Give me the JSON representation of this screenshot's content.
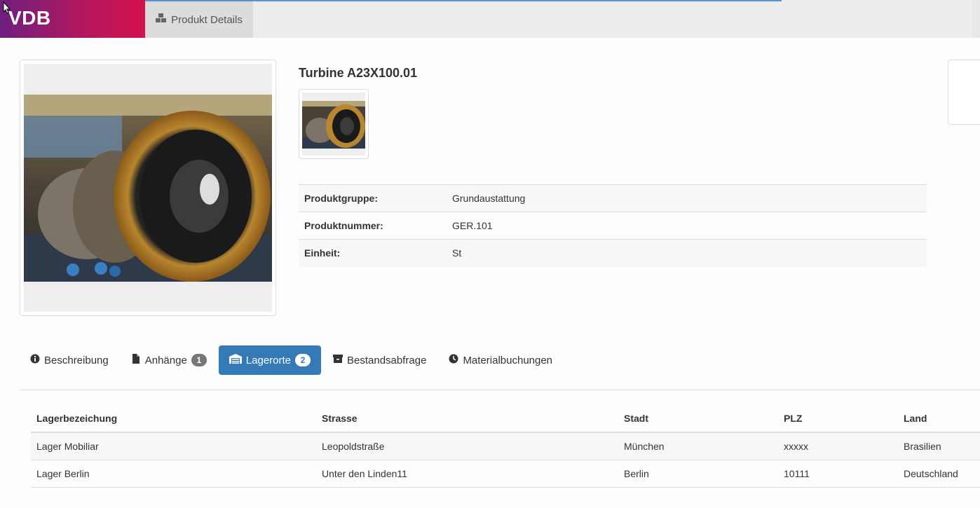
{
  "header": {
    "brand": "VDB",
    "nav_tab_label": "Produkt Details",
    "nav_tab_icon": "cubes-icon"
  },
  "product": {
    "title": "Turbine A23X100.01",
    "details": [
      {
        "label": "Produktgruppe:",
        "value": "Grundaustattung"
      },
      {
        "label": "Produktnummer:",
        "value": "GER.101"
      },
      {
        "label": "Einheit:",
        "value": "St"
      }
    ]
  },
  "tabs": [
    {
      "label": "Beschreibung",
      "icon": "info-circle-icon",
      "badge": null,
      "active": false
    },
    {
      "label": "Anhänge",
      "icon": "file-icon",
      "badge": "1",
      "active": false
    },
    {
      "label": "Lagerorte",
      "icon": "warehouse-icon",
      "badge": "2",
      "active": true
    },
    {
      "label": "Bestandsabfrage",
      "icon": "archive-icon",
      "badge": null,
      "active": false
    },
    {
      "label": "Materialbuchungen",
      "icon": "clock-icon",
      "badge": null,
      "active": false
    }
  ],
  "locations": {
    "columns": [
      "Lagerbezeichung",
      "Strasse",
      "Stadt",
      "PLZ",
      "Land"
    ],
    "rows": [
      [
        "Lager Mobiliar",
        "Leopoldstraße",
        "München",
        "xxxxx",
        "Brasilien"
      ],
      [
        "Lager Berlin",
        "Unter den Linden11",
        "Berlin",
        "10111",
        "Deutschland"
      ]
    ]
  },
  "colors": {
    "primary": "#337ab7",
    "brand_start": "#6e1f7e",
    "brand_end": "#d4124d"
  }
}
